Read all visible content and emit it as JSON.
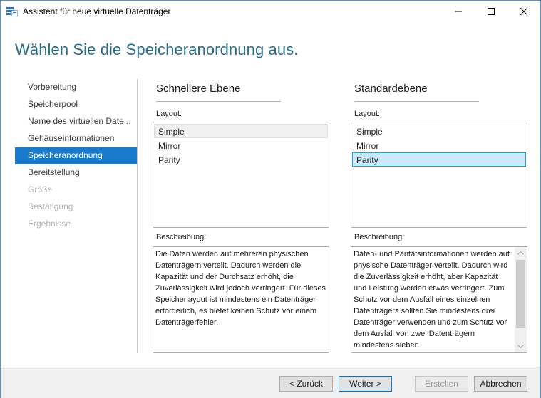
{
  "window": {
    "title": "Assistent für neue virtuelle Datenträger",
    "icons": {
      "app": "storage-wizard-icon",
      "minimize": "minimize-icon",
      "maximize": "maximize-icon",
      "close": "close-icon"
    }
  },
  "page": {
    "heading": "Wählen Sie die Speicheranordnung aus."
  },
  "sidebar": {
    "items": [
      {
        "label": "Vorbereitung",
        "state": "normal"
      },
      {
        "label": "Speicherpool",
        "state": "normal"
      },
      {
        "label": "Name des virtuellen Date...",
        "state": "normal"
      },
      {
        "label": "Gehäuseinformationen",
        "state": "normal"
      },
      {
        "label": "Speicheranordnung",
        "state": "active"
      },
      {
        "label": "Bereitstellung",
        "state": "normal"
      },
      {
        "label": "Größe",
        "state": "disabled"
      },
      {
        "label": "Bestätigung",
        "state": "disabled"
      },
      {
        "label": "Ergebnisse",
        "state": "disabled"
      }
    ]
  },
  "fast_tier": {
    "heading": "Schnellere Ebene",
    "layout_label": "Layout:",
    "options": [
      "Simple",
      "Mirror",
      "Parity"
    ],
    "highlighted": "Simple",
    "description_label": "Beschreibung:",
    "description": "Die Daten werden auf mehreren physischen Datenträgern verteilt. Dadurch werden die Kapazität und der Durchsatz erhöht, die Zuverlässigkeit wird jedoch verringert. Für dieses Speicherlayout ist mindestens ein Datenträger erforderlich, es bietet keinen Schutz vor einem Datenträgerfehler."
  },
  "standard_tier": {
    "heading": "Standardebene",
    "layout_label": "Layout:",
    "options": [
      "Simple",
      "Mirror",
      "Parity"
    ],
    "selected": "Parity",
    "description_label": "Beschreibung:",
    "description": "Daten- und Paritätsinformationen werden auf physische Datenträger verteilt. Dadurch wird die Zuverlässigkeit erhöht, aber Kapazität und Leistung werden etwas verringert. Zum Schutz vor dem Ausfall eines einzelnen Datenträgers sollten Sie mindestens drei Datenträger verwenden und zum Schutz vor dem Ausfall von zwei Datenträgern mindestens sieben"
  },
  "footer": {
    "back_label": "< Zurück",
    "next_label": "Weiter >",
    "create_label": "Erstellen",
    "cancel_label": "Abbrechen"
  },
  "colors": {
    "heading": "#2a6f8e",
    "nav_active": "#1979ca",
    "list_selected": "#cce8ff",
    "list_selected_border": "#26a0da"
  }
}
